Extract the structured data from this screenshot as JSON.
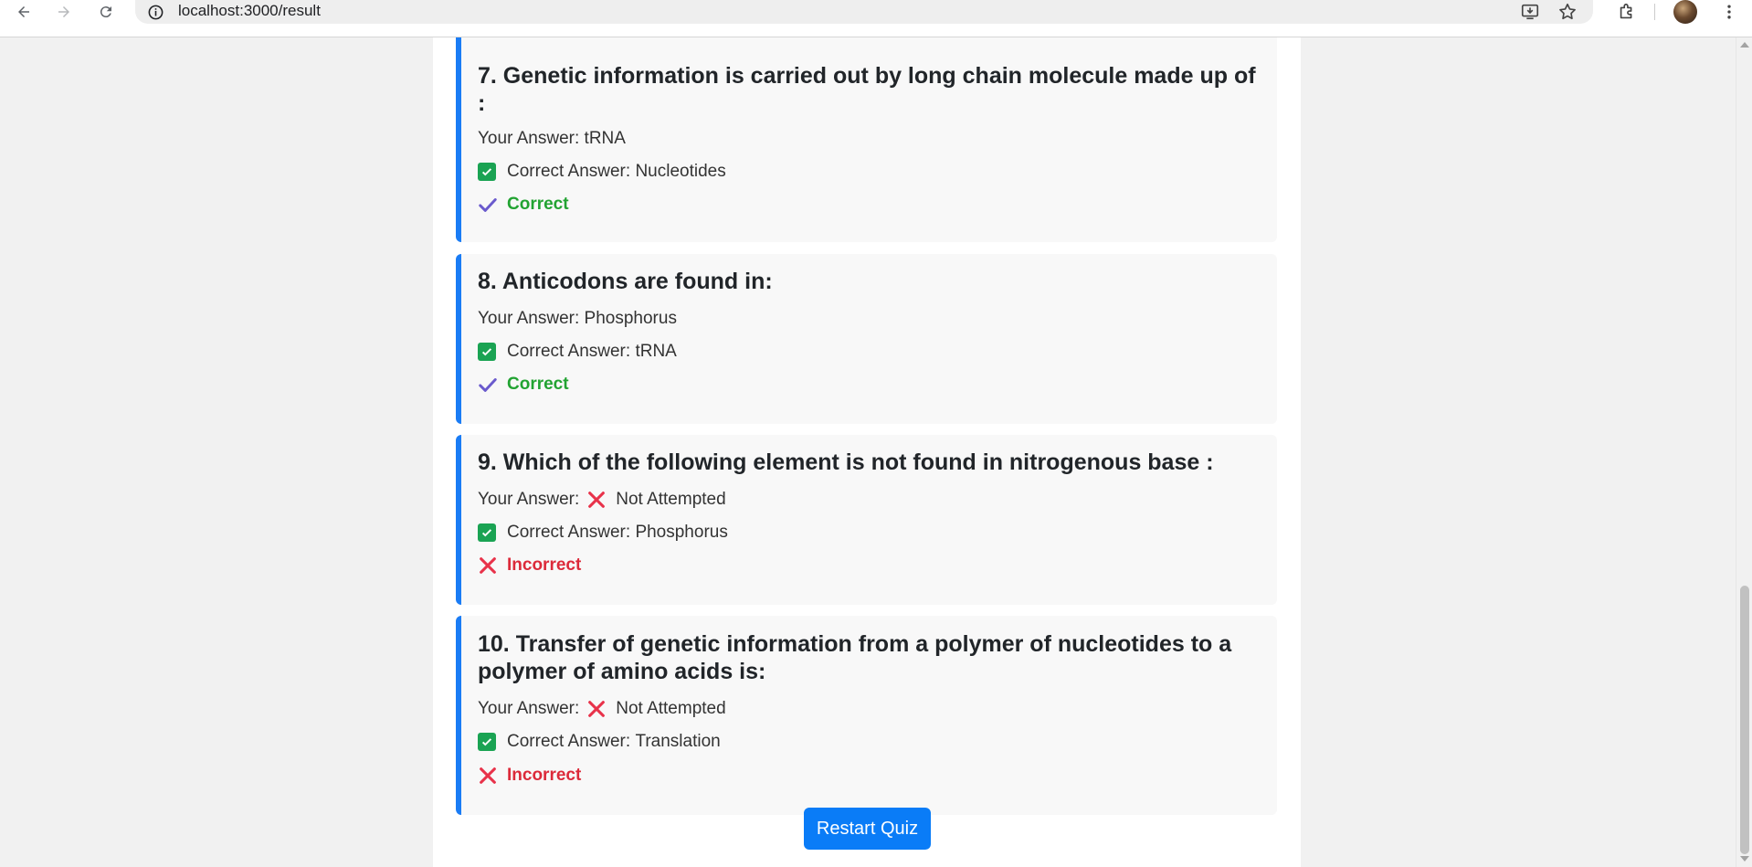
{
  "browser": {
    "url": "localhost:3000/result"
  },
  "questions": [
    {
      "title": "7. Genetic information is carried out by long chain molecule made up of :",
      "your_answer_label": "Your Answer:",
      "your_answer": "tRNA",
      "correct_answer_label": "Correct Answer:",
      "correct_answer": "Nucleotides",
      "status": "Correct"
    },
    {
      "title": "8. Anticodons are found in:",
      "your_answer_label": "Your Answer:",
      "your_answer": "Phosphorus",
      "correct_answer_label": "Correct Answer:",
      "correct_answer": "tRNA",
      "status": "Correct"
    },
    {
      "title": "9. Which of the following element is not found in nitrogenous base :",
      "your_answer_label": "Your Answer:",
      "your_answer": "Not Attempted",
      "correct_answer_label": "Correct Answer:",
      "correct_answer": "Phosphorus",
      "status": "Incorrect"
    },
    {
      "title": "10. Transfer of genetic information from a polymer of nucleotides to a polymer of amino acids is:",
      "your_answer_label": "Your Answer:",
      "your_answer": "Not Attempted",
      "correct_answer_label": "Correct Answer:",
      "correct_answer": "Translation",
      "status": "Incorrect"
    }
  ],
  "restart_label": "Restart Quiz",
  "colors": {
    "accent": "#1a7cf5",
    "correct": "#22a332",
    "incorrect": "#dc2a3a",
    "check_box": "#1aa353",
    "tick": "#6a5acd"
  },
  "icons": {
    "back": "arrow-left-icon",
    "forward": "arrow-right-icon",
    "reload": "reload-icon",
    "info": "info-icon",
    "install": "install-app-icon",
    "bookmark": "star-icon",
    "extensions": "puzzle-icon",
    "menu": "kebab-menu-icon",
    "correct_answer": "check-box-icon",
    "correct": "check-mark-icon",
    "incorrect": "cross-mark-icon"
  }
}
